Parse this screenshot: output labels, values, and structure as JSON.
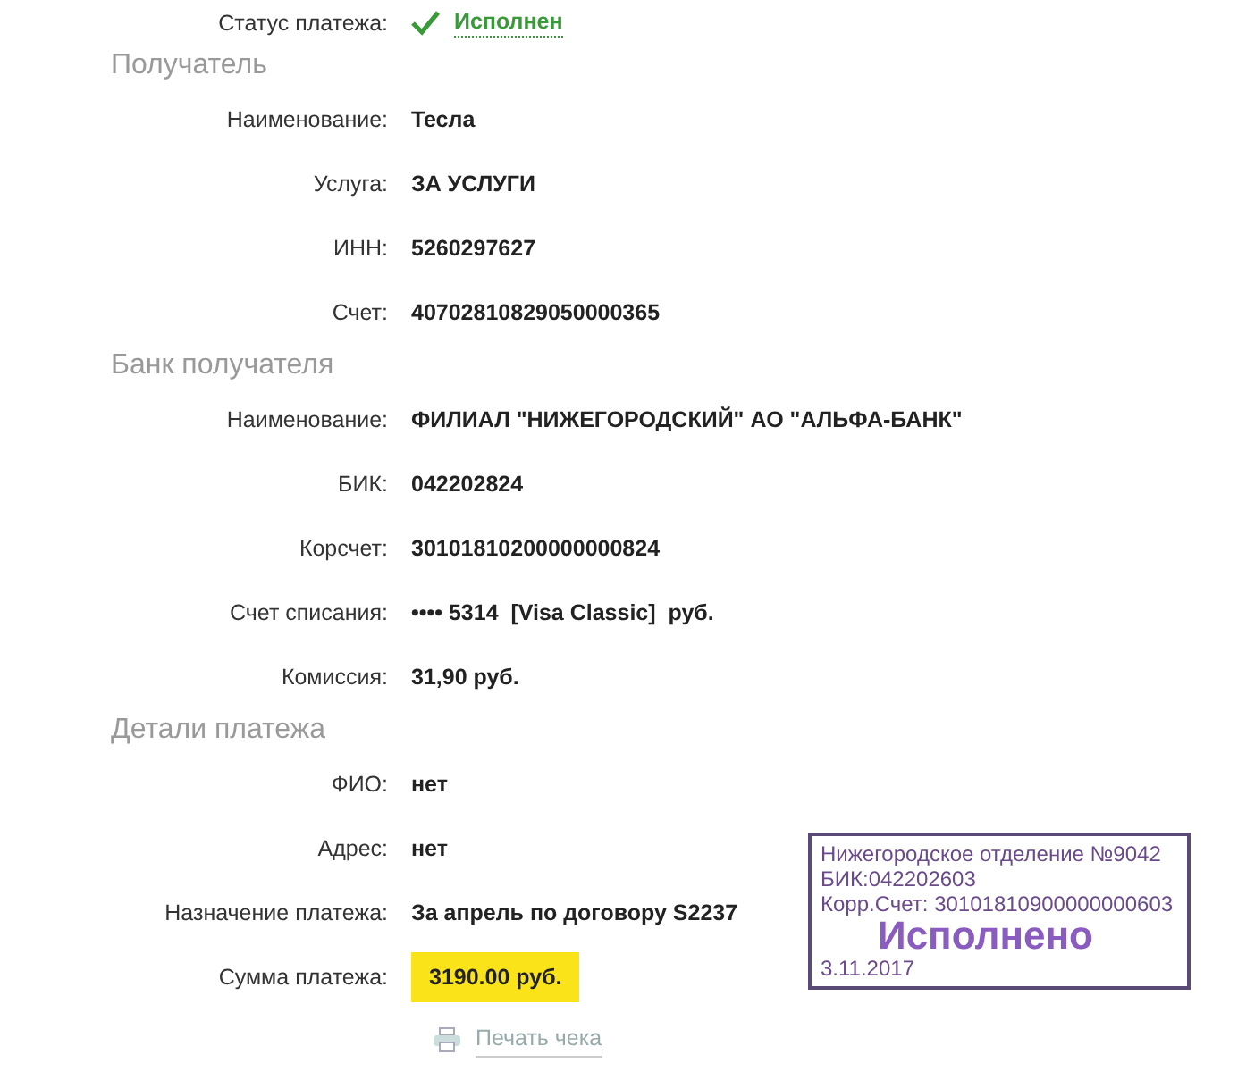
{
  "status": {
    "label": "Статус платежа:",
    "value": "Исполнен"
  },
  "sections": [
    {
      "title": "Получатель",
      "fields": [
        {
          "label": "Наименование:",
          "value": "Тесла",
          "highlighted": false
        },
        {
          "label": "Услуга:",
          "value": "ЗА УСЛУГИ",
          "highlighted": false
        },
        {
          "label": "ИНН:",
          "value": "5260297627",
          "highlighted": false
        },
        {
          "label": "Счет:",
          "value": "40702810829050000365",
          "highlighted": false
        }
      ]
    },
    {
      "title": "Банк получателя",
      "fields": [
        {
          "label": "Наименование:",
          "value": "ФИЛИАЛ \"НИЖЕГОРОДСКИЙ\" АО \"АЛЬФА-БАНК\"",
          "highlighted": false
        },
        {
          "label": "БИК:",
          "value": "042202824",
          "highlighted": false
        },
        {
          "label": "Корсчет:",
          "value": "30101810200000000824",
          "highlighted": false
        },
        {
          "label": "Счет списания:",
          "value": "•••• 5314  [Visa Classic]  руб.",
          "highlighted": false
        },
        {
          "label": "Комиссия:",
          "value": "31,90 руб.",
          "highlighted": false
        }
      ]
    },
    {
      "title": "Детали платежа",
      "fields": [
        {
          "label": "ФИО:",
          "value": "нет",
          "highlighted": false
        },
        {
          "label": "Адрес:",
          "value": "нет",
          "highlighted": false
        },
        {
          "label": "Назначение платежа:",
          "value": "За апрель по договору S2237",
          "highlighted": false
        },
        {
          "label": "Сумма платежа:",
          "value": "3190.00 руб.",
          "highlighted": true
        }
      ]
    }
  ],
  "print_link": "Печать чека",
  "stamp": {
    "lines": [
      "Нижегородское отделение №9042",
      "БИК:042202603",
      "Корр.Счет: 30101810900000000603"
    ],
    "mark": "Исполнено",
    "date": "3.11.2017"
  }
}
